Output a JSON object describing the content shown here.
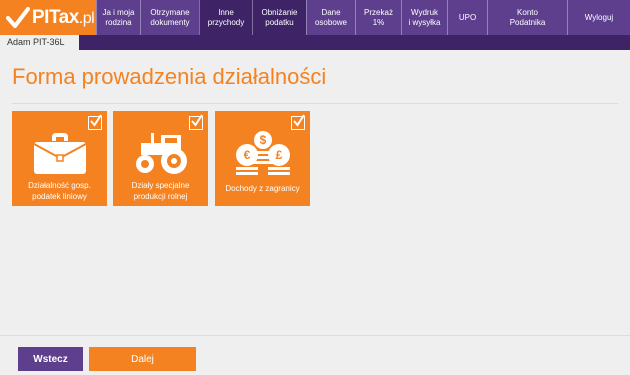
{
  "app": {
    "logo_main": "PITax",
    "logo_suffix": ".pl"
  },
  "nav": [
    {
      "label": "Ja i moja\nrodzina"
    },
    {
      "label": "Otrzymane\ndokumenty"
    },
    {
      "label": "Inne\nprzychody"
    },
    {
      "label": "Obniżanie\npodatku"
    },
    {
      "label": "Dane\nosobowe"
    },
    {
      "label": "Przekaż\n1%"
    },
    {
      "label": "Wydruk\ni wysyłka"
    },
    {
      "label": "UPO"
    },
    {
      "label": "Konto\nPodatnika"
    },
    {
      "label": "Wyloguj"
    }
  ],
  "user_tab": "Adam PIT-36L",
  "page_title": "Forma prowadzenia działalności",
  "tiles": [
    {
      "label": "Działalność gosp.\npodatek liniowy",
      "icon": "briefcase-icon",
      "checked": true
    },
    {
      "label": "Działy specjalne\nprodukcji rolnej",
      "icon": "tractor-icon",
      "checked": true
    },
    {
      "label": "Dochody z zagranicy",
      "icon": "coins-icon",
      "checked": true
    }
  ],
  "buttons": {
    "back": "Wstecz",
    "next": "Dalej"
  },
  "colors": {
    "brand_orange": "#f58220",
    "brand_purple": "#5d3f8e",
    "dark_purple": "#3e2367",
    "background": "#efefef"
  }
}
